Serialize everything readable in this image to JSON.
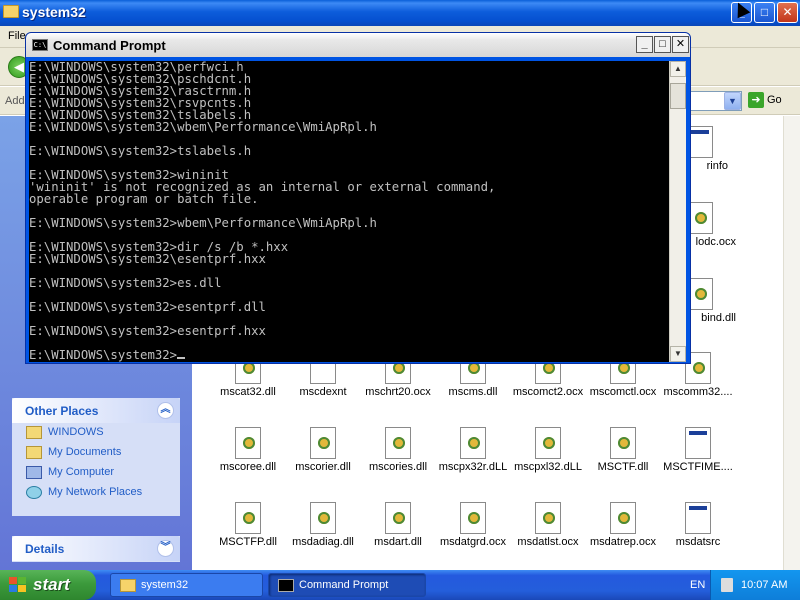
{
  "explorer": {
    "title": "system32",
    "menu_file": "File",
    "address_label": "Address",
    "go_label": "Go"
  },
  "other_places": {
    "heading": "Other Places",
    "links": [
      "WINDOWS",
      "My Documents",
      "My Computer",
      "My Network Places"
    ]
  },
  "details": {
    "heading": "Details"
  },
  "files_partial": [
    "rinfo",
    "lodc.ocx",
    "bind.dll"
  ],
  "files_row1": [
    "mscat32.dll",
    "mscdexnt",
    "mschrt20.ocx",
    "mscms.dll",
    "mscomct2.ocx",
    "mscomctl.ocx",
    "mscomm32...."
  ],
  "files_row2": [
    "mscoree.dll",
    "mscorier.dll",
    "mscories.dll",
    "mscpx32r.dLL",
    "mscpxl32.dLL",
    "MSCTF.dll",
    "MSCTFIME...."
  ],
  "files_row3": [
    "MSCTFP.dll",
    "msdadiag.dll",
    "msdart.dll",
    "msdatgrd.ocx",
    "msdatlst.ocx",
    "msdatrep.ocx",
    "msdatsrc"
  ],
  "cmd": {
    "title": "Command Prompt",
    "icon_text": "C:\\",
    "output": "E:\\WINDOWS\\system32\\perfwci.h\nE:\\WINDOWS\\system32\\pschdcnt.h\nE:\\WINDOWS\\system32\\rasctrnm.h\nE:\\WINDOWS\\system32\\rsvpcnts.h\nE:\\WINDOWS\\system32\\tslabels.h\nE:\\WINDOWS\\system32\\wbem\\Performance\\WmiApRpl.h\n\nE:\\WINDOWS\\system32>tslabels.h\n\nE:\\WINDOWS\\system32>wininit\n'wininit' is not recognized as an internal or external command,\noperable program or batch file.\n\nE:\\WINDOWS\\system32>wbem\\Performance\\WmiApRpl.h\n\nE:\\WINDOWS\\system32>dir /s /b *.hxx\nE:\\WINDOWS\\system32\\esentprf.hxx\n\nE:\\WINDOWS\\system32>es.dll\n\nE:\\WINDOWS\\system32>esentprf.dll\n\nE:\\WINDOWS\\system32>esentprf.hxx\n\nE:\\WINDOWS\\system32>"
  },
  "taskbar": {
    "start_label": "start",
    "tasks": [
      "system32",
      "Command Prompt"
    ],
    "language": "EN",
    "clock": "10:07 AM"
  },
  "colors": {
    "titlebar_blue": "#0054e3",
    "start_green": "#3c9a3c",
    "link_blue": "#215dc6",
    "console_text": "#c0c0c0"
  }
}
